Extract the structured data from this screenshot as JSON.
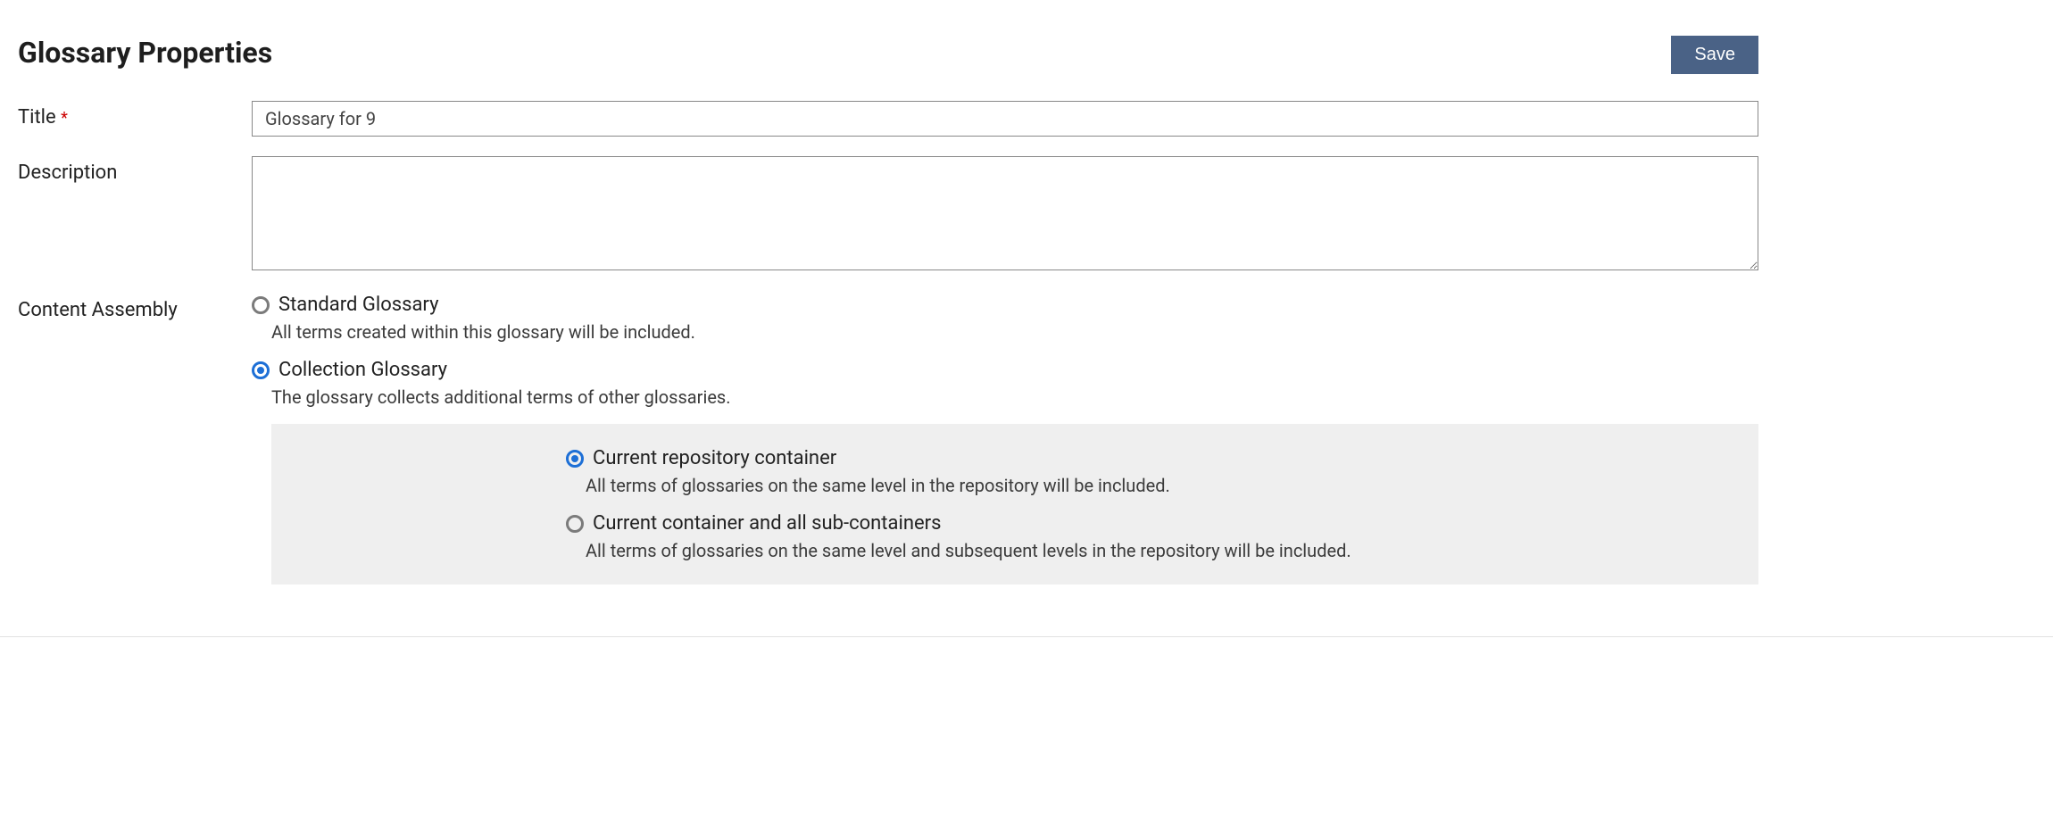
{
  "header": {
    "title": "Glossary Properties",
    "save_label": "Save"
  },
  "labels": {
    "title": "Title",
    "required_mark": "*",
    "description": "Description",
    "content_assembly": "Content Assembly"
  },
  "fields": {
    "title_value": "Glossary for 9",
    "description_value": ""
  },
  "content_assembly": {
    "options": [
      {
        "label": "Standard Glossary",
        "desc": "All terms created within this glossary will be included.",
        "selected": false
      },
      {
        "label": "Collection Glossary",
        "desc": "The glossary collects additional terms of other glossaries.",
        "selected": true
      }
    ],
    "collection_sub": [
      {
        "label": "Current repository container",
        "desc": "All terms of glossaries on the same level in the repository will be included.",
        "selected": true
      },
      {
        "label": "Current container and all sub-containers",
        "desc": "All terms of glossaries on the same level and subsequent levels in the repository will be included.",
        "selected": false
      }
    ]
  }
}
